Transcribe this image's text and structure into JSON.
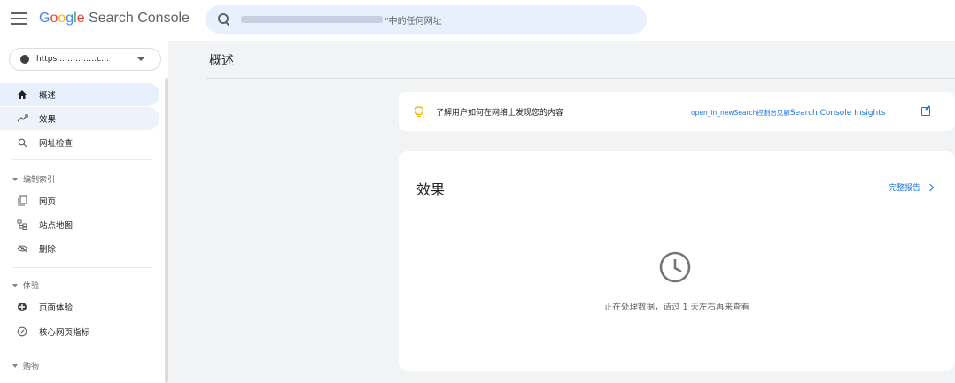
{
  "app": {
    "logo_google": [
      "G",
      "o",
      "o",
      "g",
      "l",
      "e"
    ],
    "logo_suffix": " Search Console"
  },
  "search": {
    "placeholder_suffix": "\"中的任何网址"
  },
  "sidebar": {
    "property_label": "https……………c…",
    "items": [
      {
        "label": "概述",
        "icon": "home-icon"
      },
      {
        "label": "效果",
        "icon": "trending-icon"
      },
      {
        "label": "网址检查",
        "icon": "search-icon"
      }
    ],
    "section_index": "编制索引",
    "index_items": [
      {
        "label": "网页",
        "icon": "pages-icon"
      },
      {
        "label": "站点地图",
        "icon": "sitemap-icon"
      },
      {
        "label": "删除",
        "icon": "hide-icon"
      }
    ],
    "section_experience": "体验",
    "experience_items": [
      {
        "label": "页面体验",
        "icon": "page-experience-icon"
      },
      {
        "label": "核心网页指标",
        "icon": "speed-icon"
      }
    ],
    "section_shopping": "购物"
  },
  "main": {
    "page_title": "概述",
    "insights": {
      "text": "了解用户如何在网络上发现您的内容",
      "link_prefix": "open_in_newSearch控制台见解",
      "link_main": "Search Console Insights"
    },
    "performance": {
      "title": "效果",
      "full_report": "完整报告",
      "status_text": "正在处理数据，请过 1 天左右再来查看"
    }
  },
  "colors": {
    "accent": "#1a73e8",
    "active_bg": "#e8f0fe",
    "background": "#f1f3f4"
  }
}
